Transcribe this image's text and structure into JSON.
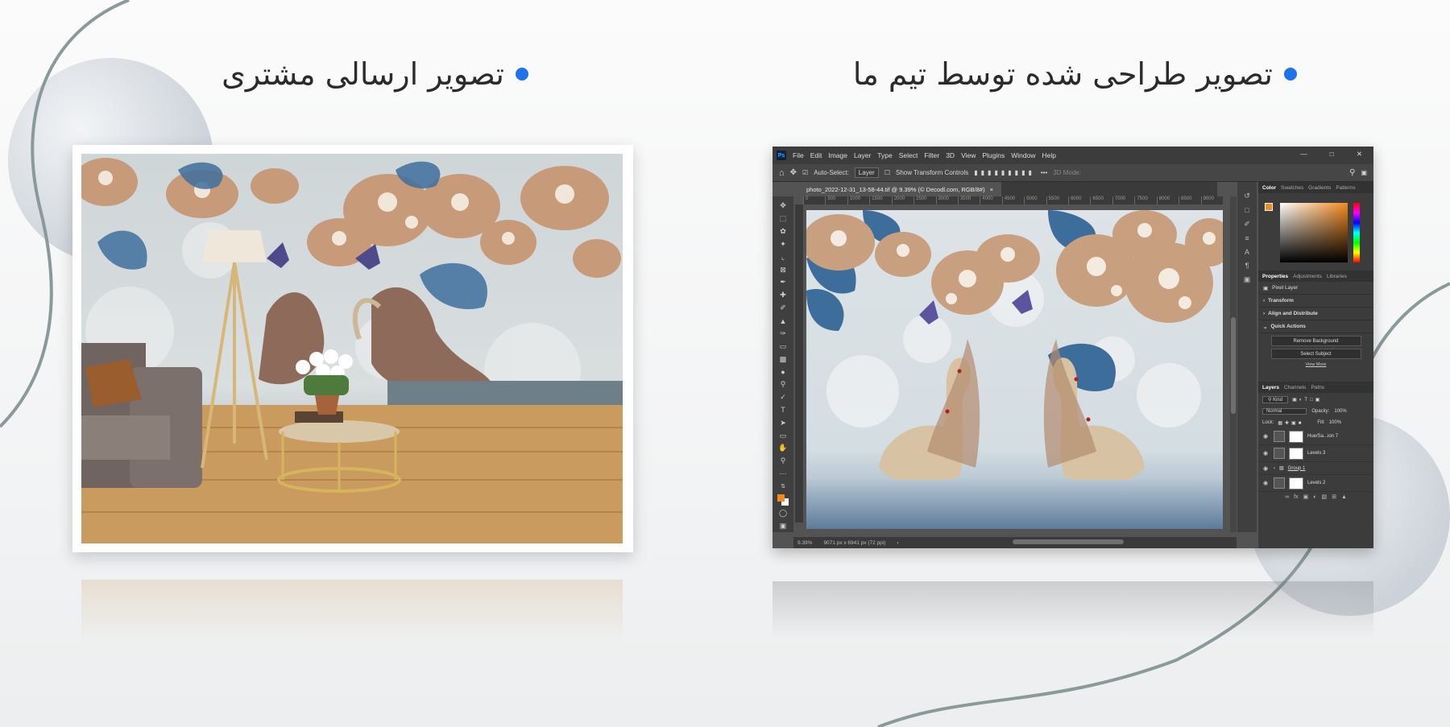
{
  "headings": {
    "right": "تصویر طراحی شده توسط تیم ما",
    "left": "تصویر ارسالی مشتری"
  },
  "colors": {
    "bullet": "#1e73e8",
    "curve": "#8a9a9a"
  },
  "photoshop": {
    "app_logo": "Ps",
    "menu": [
      "File",
      "Edit",
      "Image",
      "Layer",
      "Type",
      "Select",
      "Filter",
      "3D",
      "View",
      "Plugins",
      "Window",
      "Help"
    ],
    "options": {
      "auto_select": "Auto-Select:",
      "layer_select": "Layer",
      "transform_controls": "Show Transform Controls",
      "mode_3d": "3D Mode:"
    },
    "doc_tab": "photo_2022-12-31_13-58-44.tif @ 9.39% (© Decodl.com, RGB/8#)",
    "ruler_ticks": [
      "0",
      "500",
      "1000",
      "1500",
      "2000",
      "2500",
      "3000",
      "3500",
      "4000",
      "4500",
      "5000",
      "5500",
      "6000",
      "6500",
      "7000",
      "7500",
      "8000",
      "8500",
      "9000"
    ],
    "status": {
      "zoom": "9.39%",
      "dimensions": "9071 px x 6941 px (72 ppi)"
    },
    "color_tabs": [
      "Color",
      "Swatches",
      "Gradients",
      "Patterns"
    ],
    "properties_tabs": [
      "Properties",
      "Adjustments",
      "Libraries"
    ],
    "properties": {
      "layer_kind": "Pixel Layer",
      "sections": [
        "Transform",
        "Align and Distribute",
        "Quick Actions"
      ],
      "buttons": [
        "Remove Background",
        "Select Subject"
      ],
      "view_more": "View More"
    },
    "layers_tabs": [
      "Layers",
      "Channels",
      "Paths"
    ],
    "layers_filter": "Kind",
    "blend_mode": "Normal",
    "opacity_label": "Opacity:",
    "opacity": "100%",
    "lock_label": "Lock:",
    "fill_label": "Fill:",
    "fill": "100%",
    "layers": [
      {
        "name": "Hue/Sa...ion 7",
        "type": "adjustment"
      },
      {
        "name": "Levels 3",
        "type": "adjustment"
      },
      {
        "name": "Group 1",
        "type": "group"
      },
      {
        "name": "Levels 2",
        "type": "adjustment"
      }
    ],
    "swatch_fg": "#f28a1f"
  }
}
